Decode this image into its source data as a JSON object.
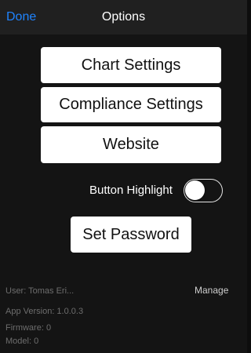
{
  "navbar": {
    "done_label": "Done",
    "title": "Options"
  },
  "menu": {
    "chart_settings": "Chart Settings",
    "compliance_settings": "Compliance Settings",
    "website": "Website"
  },
  "toggle": {
    "label": "Button Highlight",
    "state": "off"
  },
  "password": {
    "label": "Set Password"
  },
  "info": {
    "user": "User:  Tomas Eri...",
    "manage_label": "Manage",
    "app_version": "App Version:  1.0.0.3",
    "firmware": "Firmware:  0",
    "model": "Model:  0"
  },
  "colors": {
    "accent": "#1f84ff",
    "background": "#141414",
    "navbar": "#202020",
    "button": "#ffffff",
    "muted_text": "#6d6d6d"
  }
}
